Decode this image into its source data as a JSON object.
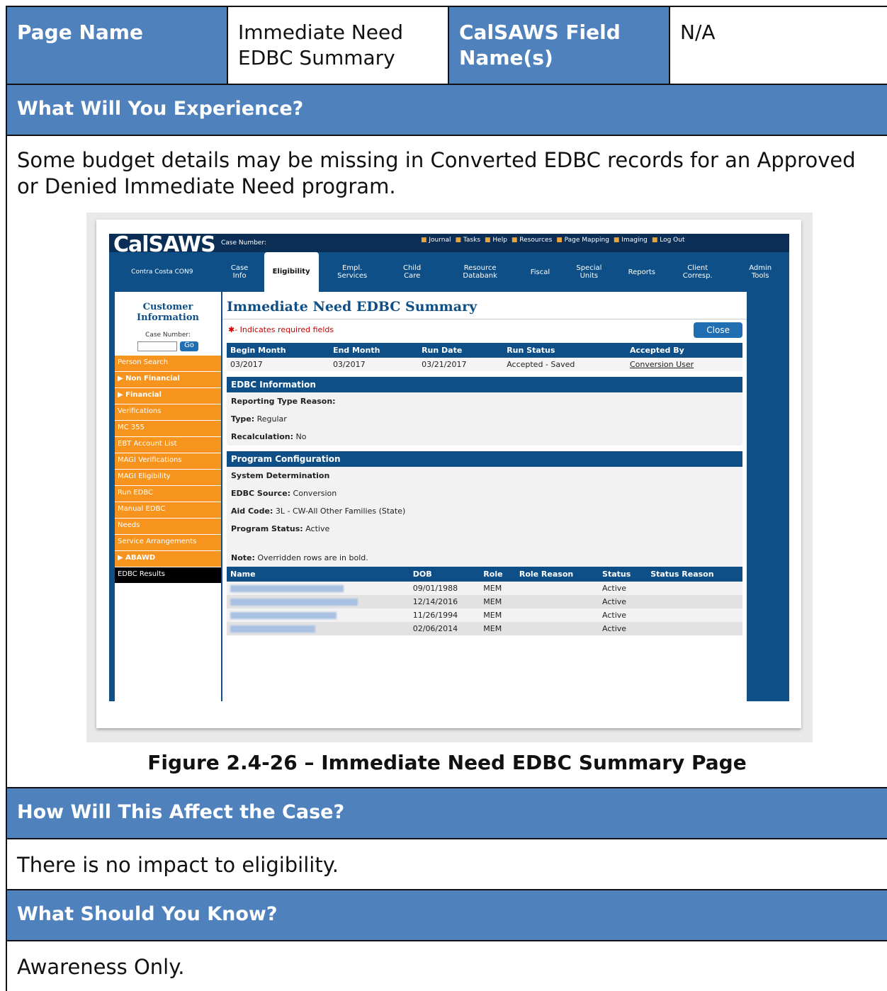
{
  "header": {
    "page_name_label": "Page Name",
    "page_name_value": "Immediate Need EDBC Summary",
    "field_label": "CalSAWS Field Name(s)",
    "field_value": "N/A"
  },
  "experience": {
    "title": "What Will You Experience?",
    "text": "Some budget details may be missing in Converted EDBC records for an Approved or Denied Immediate Need program."
  },
  "figure": {
    "caption": "Figure 2.4-26 – Immediate Need EDBC Summary Page",
    "logo": "CalSAWS",
    "case_number_label": "Case Number:",
    "top_links": [
      "Journal",
      "Tasks",
      "Help",
      "Resources",
      "Page Mapping",
      "Imaging",
      "Log Out"
    ],
    "county": "Contra Costa CON9",
    "tabs": [
      "Case Info",
      "Eligibility",
      "Empl. Services",
      "Child Care",
      "Resource Databank",
      "Fiscal",
      "Special Units",
      "Reports",
      "Client Corresp.",
      "Admin Tools"
    ],
    "side_title": "Customer Information",
    "side_case_label": "Case Number:",
    "go_label": "Go",
    "side_items": [
      "Person Search",
      "▶ Non Financial",
      "▶ Financial",
      "Verifications",
      "MC 355",
      "EBT Account List",
      "MAGI Verifications",
      "MAGI Eligibility",
      "Run EDBC",
      "Manual EDBC",
      "Needs",
      "Service Arrangements",
      "▶ ABAWD",
      "EDBC Results"
    ],
    "main_title": "Immediate Need EDBC Summary",
    "required_note": "✱- Indicates required fields",
    "close_label": "Close",
    "summary_headers": [
      "Begin Month",
      "End Month",
      "Run Date",
      "Run Status",
      "Accepted By"
    ],
    "summary_row": [
      "03/2017",
      "03/2017",
      "03/21/2017",
      "Accepted - Saved",
      "Conversion User"
    ],
    "edbc_info_title": "EDBC Information",
    "reporting_type_label": "Reporting Type Reason:",
    "type_label": "Type:",
    "type_value": "Regular",
    "recalc_label": "Recalculation:",
    "recalc_value": "No",
    "program_config_title": "Program Configuration",
    "system_determination": "System Determination",
    "edbc_source_label": "EDBC Source:",
    "edbc_source_value": "Conversion",
    "aid_code_label": "Aid Code:",
    "aid_code_value": "3L - CW-All Other Families (State)",
    "program_status_label": "Program Status:",
    "program_status_value": "Active",
    "note_label": "Note:",
    "note_text": "Overridden rows are in bold.",
    "person_headers": [
      "Name",
      "DOB",
      "Role",
      "Role Reason",
      "Status",
      "Status Reason"
    ],
    "person_rows": [
      [
        "09/01/1988",
        "MEM",
        "",
        "Active",
        ""
      ],
      [
        "12/14/2016",
        "MEM",
        "",
        "Active",
        ""
      ],
      [
        "11/26/1994",
        "MEM",
        "",
        "Active",
        ""
      ],
      [
        "02/06/2014",
        "MEM",
        "",
        "Active",
        ""
      ]
    ]
  },
  "affect": {
    "title": "How Will This Affect the Case?",
    "text": "There is no impact to eligibility."
  },
  "know": {
    "title": "What Should You Know?",
    "text": "Awareness Only."
  }
}
